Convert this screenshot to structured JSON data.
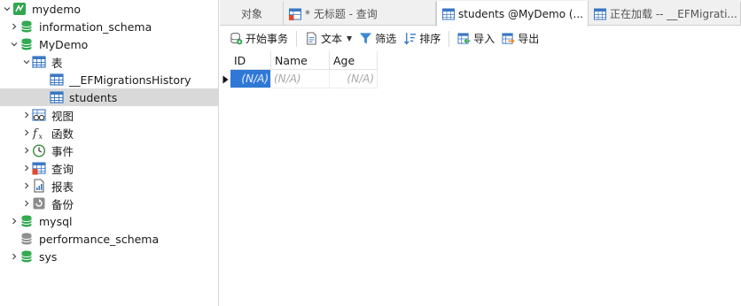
{
  "navigator": {
    "items": [
      {
        "label": "mydemo",
        "arrow": "down",
        "icon": "connection-icon"
      },
      {
        "label": "information_schema",
        "arrow": "right",
        "icon": "database-icon"
      },
      {
        "label": "MyDemo",
        "arrow": "down",
        "icon": "database-icon"
      },
      {
        "label": "表",
        "arrow": "down",
        "icon": "tables-icon"
      },
      {
        "label": "__EFMigrationsHistory",
        "arrow": "",
        "icon": "table-icon"
      },
      {
        "label": "students",
        "arrow": "",
        "icon": "table-icon",
        "selected": true
      },
      {
        "label": "视图",
        "arrow": "right",
        "icon": "view-icon"
      },
      {
        "label": "函数",
        "arrow": "right",
        "icon": "function-icon"
      },
      {
        "label": "事件",
        "arrow": "right",
        "icon": "event-icon"
      },
      {
        "label": "查询",
        "arrow": "right",
        "icon": "query-icon"
      },
      {
        "label": "报表",
        "arrow": "right",
        "icon": "report-icon"
      },
      {
        "label": "备份",
        "arrow": "right",
        "icon": "backup-icon"
      },
      {
        "label": "mysql",
        "arrow": "right",
        "icon": "database-icon"
      },
      {
        "label": "performance_schema",
        "arrow": "",
        "icon": "database-icon-gray"
      },
      {
        "label": "sys",
        "arrow": "right",
        "icon": "database-icon"
      }
    ]
  },
  "tabs": [
    {
      "label": "对象",
      "icon": ""
    },
    {
      "label": "* 无标题 - 查询",
      "icon": "query-tab-icon"
    },
    {
      "label": "students @MyDemo (...",
      "icon": "table-tab-icon",
      "active": true
    },
    {
      "label": "正在加载 -- __EFMigrati...",
      "icon": "table-tab-icon"
    }
  ],
  "toolbar": {
    "begin_transaction": "开始事务",
    "text": "文本",
    "filter": "筛选",
    "sort": "排序",
    "import": "导入",
    "export": "导出"
  },
  "grid": {
    "columns": [
      "ID",
      "Name",
      "Age"
    ],
    "rows": [
      [
        "(N/A)",
        "(N/A)",
        "(N/A)"
      ]
    ]
  },
  "colors": {
    "accent": "#2f78d6",
    "db_green": "#2fa84f",
    "table_blue": "#3b78c4"
  }
}
